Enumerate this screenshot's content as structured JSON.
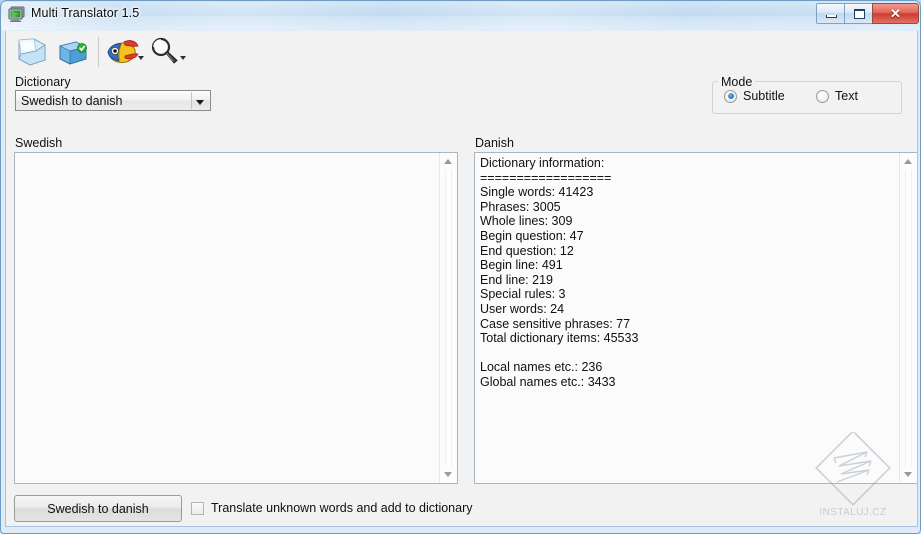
{
  "window": {
    "title": "Multi Translator 1.5",
    "icon": "app-monitor-icon",
    "buttons": {
      "minimize": "minimize",
      "maximize": "maximize",
      "close": "✕"
    }
  },
  "toolbar": {
    "items": [
      {
        "name": "open-file-icon",
        "label": "Open"
      },
      {
        "name": "save-file-icon",
        "label": "Save"
      },
      {
        "name": "babelfish-icon",
        "label": "Babelfish translate",
        "has_dropdown": true
      },
      {
        "name": "magnifier-icon",
        "label": "Search",
        "has_dropdown": true
      }
    ]
  },
  "dictionary": {
    "label": "Dictionary",
    "selected": "Swedish to danish",
    "options": [
      "Swedish to danish"
    ]
  },
  "mode": {
    "title": "Mode",
    "options": [
      {
        "label": "Subtitle",
        "selected": true
      },
      {
        "label": "Text",
        "selected": false
      }
    ]
  },
  "source_panel": {
    "label": "Swedish",
    "text": ""
  },
  "target_panel": {
    "label": "Danish",
    "text": "Dictionary information:\n==================\nSingle words: 41423\nPhrases: 3005\nWhole lines: 309\nBegin question: 47\nEnd question: 12\nBegin line: 491\nEnd line: 219\nSpecial rules: 3\nUser words: 24\nCase sensitive phrases: 77\nTotal dictionary items: 45533\n\nLocal names etc.: 236\nGlobal names etc.: 3433"
  },
  "bottom": {
    "translate_button": "Swedish to danish",
    "checkbox_label": "Translate unknown words and add to dictionary",
    "checkbox_checked": false
  },
  "watermark": {
    "text": "INSTALUJ.CZ"
  },
  "colors": {
    "accent": "#2878be",
    "title_bar": "#bcd8ef",
    "close_button": "#cf3b2c",
    "frame_border": "#6f9cc4"
  }
}
